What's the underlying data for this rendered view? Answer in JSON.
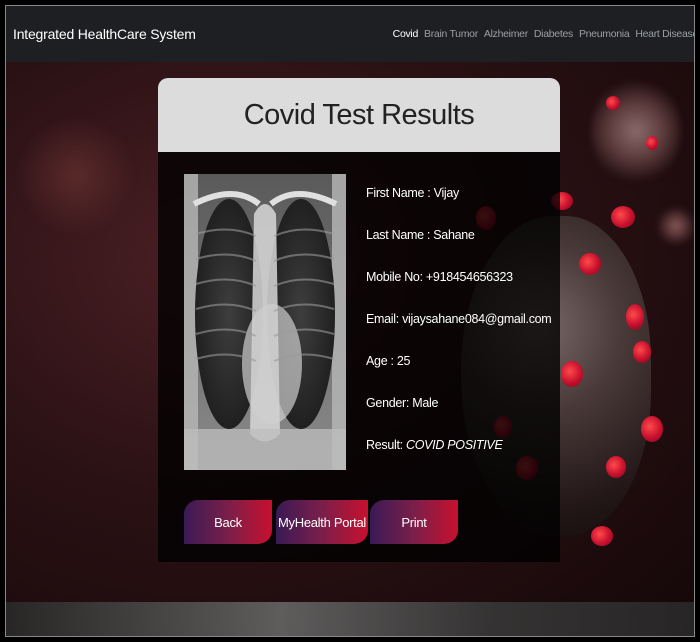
{
  "navbar": {
    "brand": "Integrated HealthCare System",
    "links": [
      "Covid",
      "Brain Tumor",
      "Alzheimer",
      "Diabetes",
      "Pneumonia",
      "Heart Disease"
    ],
    "active": "Covid"
  },
  "card": {
    "title": "Covid Test Results"
  },
  "patient": {
    "first_name": "First Name : Vijay",
    "last_name": "Last Name : Sahane",
    "mobile": "Mobile No: +918454656323",
    "email": "Email: vijaysahane084@gmail.com",
    "age": "Age : 25",
    "gender": "Gender: Male",
    "result_label": "Result: ",
    "result_value": "COVID POSITIVE"
  },
  "buttons": {
    "back": "Back",
    "portal": "MyHealth Portal",
    "print": "Print"
  },
  "colors": {
    "navbar_bg": "#1d1f22",
    "card_header_bg": "#dcdcdc",
    "button_gradient_start": "#3a1a55",
    "button_gradient_end": "#c8102e",
    "accent_red": "#c8102e"
  }
}
